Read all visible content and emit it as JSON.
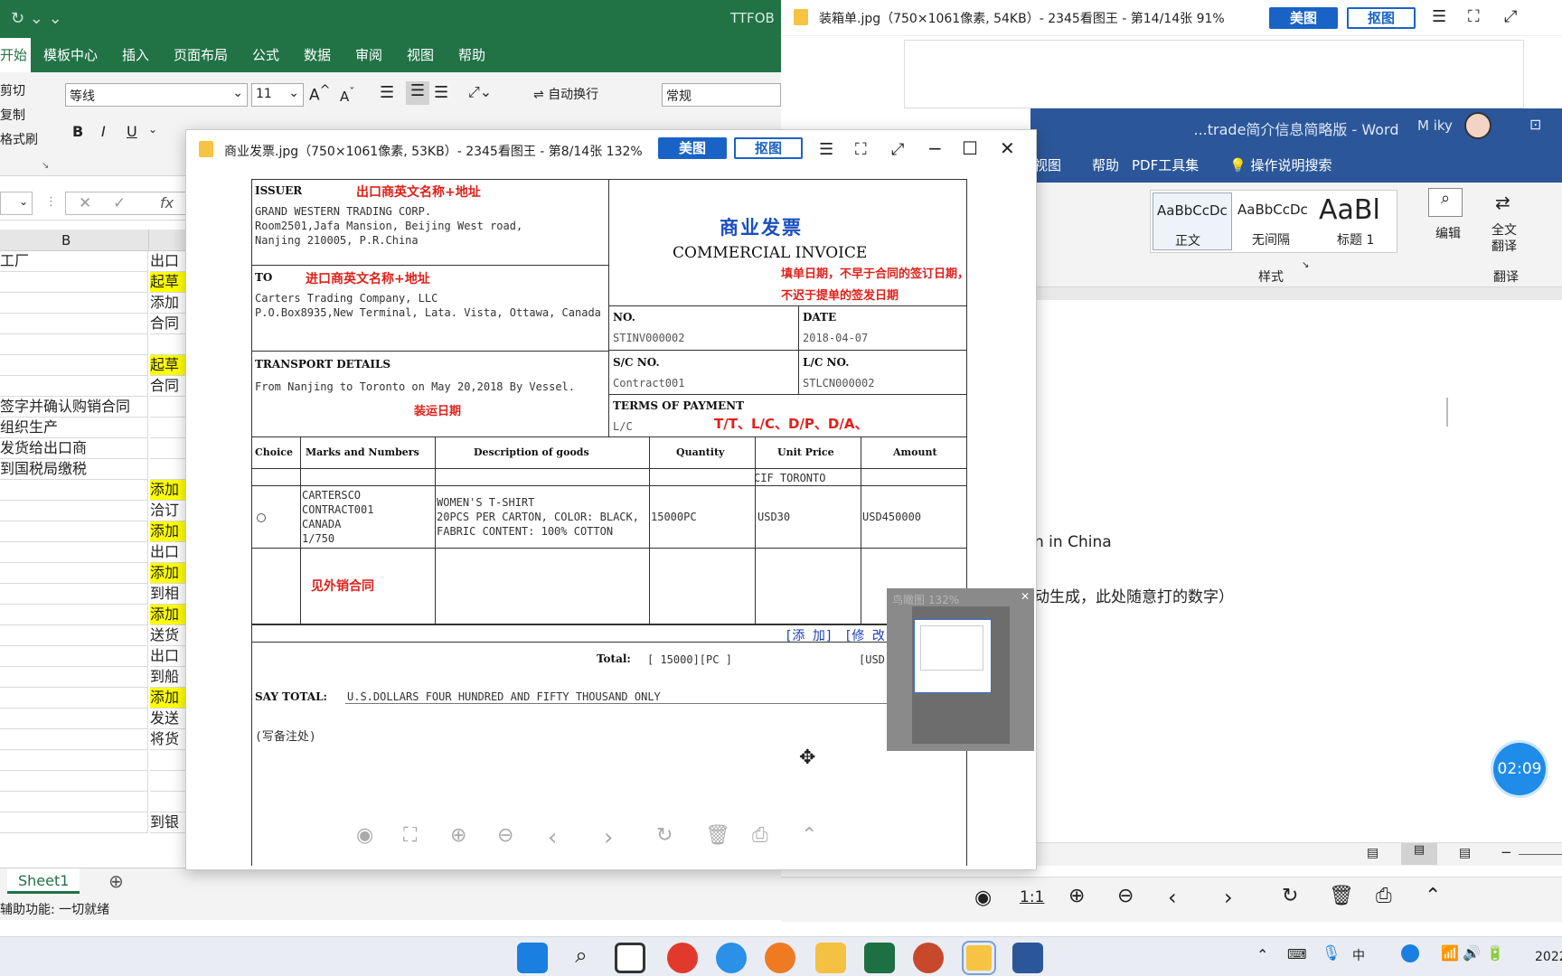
{
  "excel": {
    "title_right": "TTFOB",
    "tabs": [
      "开始",
      "模板中心",
      "插入",
      "页面布局",
      "公式",
      "数据",
      "审阅",
      "视图",
      "帮助"
    ],
    "clipboard": [
      "剪切",
      "复制",
      "格式刷"
    ],
    "font_name": "等线",
    "font_size": "11",
    "wrap_label": "自动换行",
    "number_format": "常规",
    "col_header": "B",
    "rows": [
      {
        "b": "工厂",
        "c": "出口",
        "hl": false
      },
      {
        "b": "",
        "c": "起草",
        "hl": true
      },
      {
        "b": "",
        "c": "添加",
        "hl": false
      },
      {
        "b": "",
        "c": "合同",
        "hl": false
      },
      {
        "b": "",
        "c": "",
        "hl": false
      },
      {
        "b": "",
        "c": "起草",
        "hl": true
      },
      {
        "b": "",
        "c": "合同",
        "hl": false
      },
      {
        "b": "签字并确认购销合同",
        "c": "",
        "hl": false
      },
      {
        "b": "组织生产",
        "c": "",
        "hl": false
      },
      {
        "b": "发货给出口商",
        "c": "",
        "hl": false
      },
      {
        "b": "到国税局缴税",
        "c": "",
        "hl": false
      },
      {
        "b": "",
        "c": "添加",
        "hl": true
      },
      {
        "b": "",
        "c": "洽订",
        "hl": false
      },
      {
        "b": "",
        "c": "添加",
        "hl": true
      },
      {
        "b": "",
        "c": "出口",
        "hl": false
      },
      {
        "b": "",
        "c": "添加",
        "hl": true
      },
      {
        "b": "",
        "c": "到相",
        "hl": false
      },
      {
        "b": "",
        "c": "添加",
        "hl": true
      },
      {
        "b": "",
        "c": "送货",
        "hl": false
      },
      {
        "b": "",
        "c": "出口",
        "hl": false
      },
      {
        "b": "",
        "c": "到船",
        "hl": false
      },
      {
        "b": "",
        "c": "添加",
        "hl": true
      },
      {
        "b": "",
        "c": "发送",
        "hl": false
      },
      {
        "b": "",
        "c": "将货",
        "hl": false
      },
      {
        "b": "",
        "c": "",
        "hl": false
      },
      {
        "b": "",
        "c": "",
        "hl": false
      },
      {
        "b": "",
        "c": "",
        "hl": false
      },
      {
        "b": "",
        "c": "到银",
        "hl": false
      }
    ],
    "sheet_tab": "Sheet1",
    "status": "辅助功能: 一切就绪"
  },
  "viewer2": {
    "title": "装箱单.jpg（750×1061像素, 54KB）- 2345看图王 - 第14/14张 91%",
    "btn_meitu": "美图",
    "btn_koutu": "抠图",
    "zoom_1_1": "1:1"
  },
  "word": {
    "title": "...trade简介信息简略版 - Word",
    "user": "M iky",
    "tabs": [
      "视图",
      "帮助",
      "PDF工具集",
      "操作说明搜索"
    ],
    "styles": [
      {
        "preview": "AaBbCcDc",
        "name": "正文"
      },
      {
        "preview": "AaBbCcDc",
        "name": "无间隔"
      },
      {
        "preview": "AaBl",
        "name": "标题 1"
      }
    ],
    "group_styles": "样式",
    "edit_label": "编辑",
    "translate_label": "全文翻译",
    "group_translate": "翻译",
    "doc_line1": "n in China",
    "doc_line2": "动生成，此处随意打的数字）"
  },
  "viewer": {
    "title": "商业发票.jpg（750×1061像素, 53KB）- 2345看图王 - 第8/14张 132%",
    "btn_meitu": "美图",
    "btn_koutu": "抠图",
    "navigator_label": "鸟瞰图 132%"
  },
  "invoice": {
    "issuer_label": "ISSUER",
    "issuer_note": "出口商英文名称+地址",
    "issuer_lines": [
      "GRAND WESTERN TRADING CORP.",
      "Room2501,Jafa Mansion, Beijing West road,",
      "Nanjing 210005, P.R.China"
    ],
    "title_cn": "商业发票",
    "title_en": "COMMERCIAL INVOICE",
    "date_note_1": "填单日期，不早于合同的签订日期，",
    "date_note_2": "不迟于提单的签发日期",
    "to_label": "TO",
    "to_note": "进口商英文名称+地址",
    "to_lines": [
      "Carters Trading Company, LLC",
      "P.O.Box8935,New Terminal, Lata. Vista, Ottawa, Canada"
    ],
    "no_label": "NO.",
    "no_value": "STINV000002",
    "date_label": "DATE",
    "date_value": "2018-04-07",
    "sc_label": "S/C NO.",
    "sc_value": "Contract001",
    "lc_label": "L/C NO.",
    "lc_value": "STLCN000002",
    "transport_label": "TRANSPORT DETAILS",
    "transport_value": "From Nanjing to Toronto on May 20,2018 By Vessel.",
    "ship_note": "装运日期",
    "terms_label": "TERMS OF PAYMENT",
    "terms_value": "L/C",
    "terms_note": "T/T、L/C、D/P、D/A、",
    "headers": [
      "Choice",
      "Marks and Numbers",
      "Description of goods",
      "Quantity",
      "Unit Price",
      "Amount"
    ],
    "price_term": "CIF TORONTO",
    "marks": [
      "CARTERSCO",
      "CONTRACT001",
      "CANADA",
      "1/750"
    ],
    "desc": [
      "WOMEN'S T-SHIRT",
      "20PCS PER CARTON, COLOR: BLACK,",
      "FABRIC CONTENT: 100% COTTON"
    ],
    "quantity": "15000PC",
    "unit_price": "USD30",
    "amount": "USD450000",
    "contract_note": "见外销合同",
    "add_link": "[添 加]",
    "edit_link": "[修 改]",
    "total_label": "Total:",
    "total_qty": "[ 15000][PC ]",
    "total_amount": "[USD][",
    "say_total_label": "SAY TOTAL:",
    "say_total_value": "U.S.DOLLARS FOUR HUNDRED AND FIFTY THOUSAND ONLY",
    "remarks": "(写备注处)"
  },
  "timer": "02:09",
  "clock": "2022"
}
